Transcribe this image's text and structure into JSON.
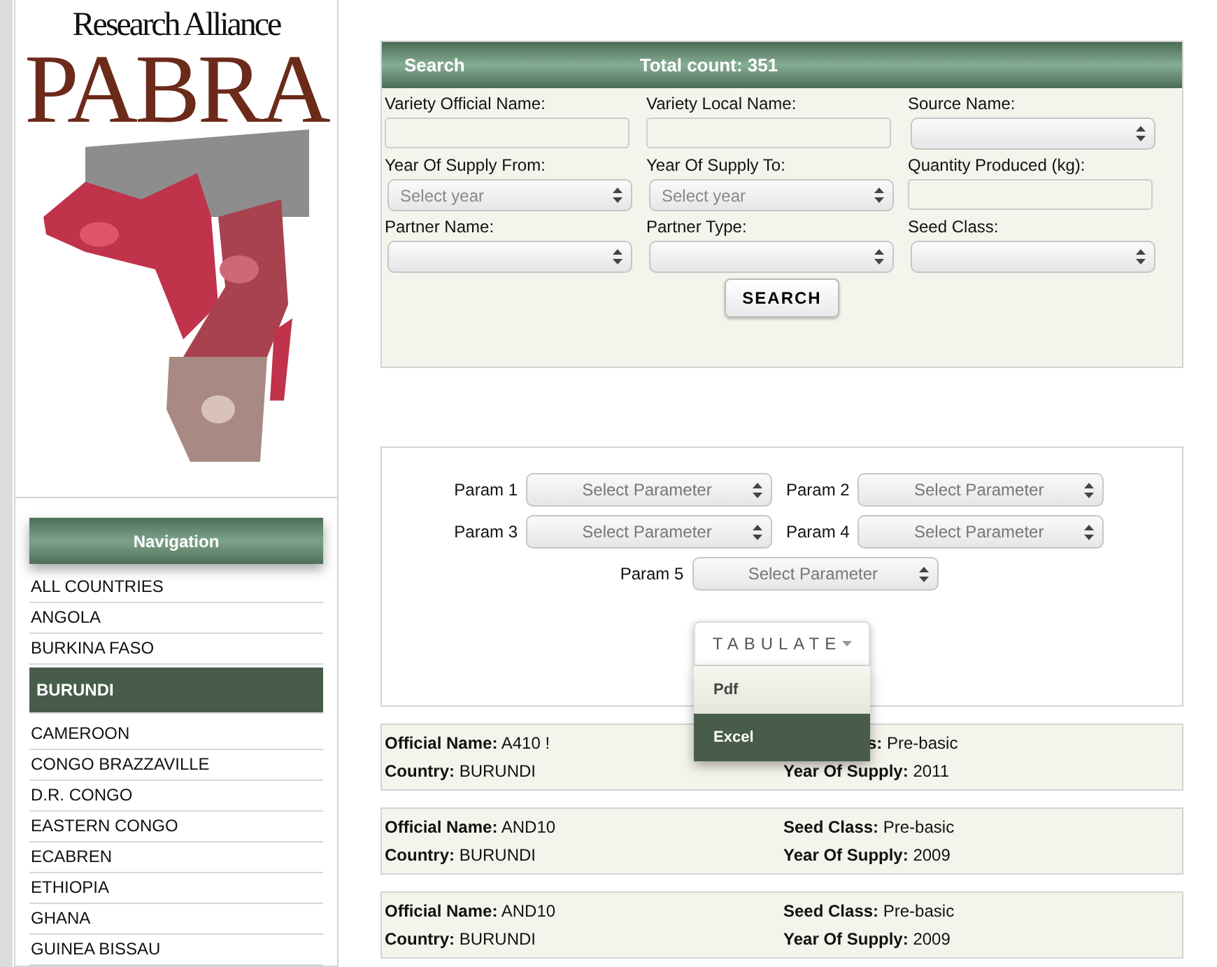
{
  "logo": {
    "subtitle": "Research Alliance",
    "title": "PABRA",
    "kind": "picture"
  },
  "navigation": {
    "title": "Navigation",
    "items": [
      {
        "label": "ALL COUNTRIES",
        "selected": false
      },
      {
        "label": "ANGOLA",
        "selected": false
      },
      {
        "label": "BURKINA FASO",
        "selected": false
      },
      {
        "label": "BURUNDI",
        "selected": true
      },
      {
        "label": "CAMEROON",
        "selected": false
      },
      {
        "label": "CONGO BRAZZAVILLE",
        "selected": false
      },
      {
        "label": "D.R. CONGO",
        "selected": false
      },
      {
        "label": "EASTERN CONGO",
        "selected": false
      },
      {
        "label": "ECABREN",
        "selected": false
      },
      {
        "label": "ETHIOPIA",
        "selected": false
      },
      {
        "label": "GHANA",
        "selected": false
      },
      {
        "label": "GUINEA BISSAU",
        "selected": false
      }
    ]
  },
  "search": {
    "title": "Search",
    "total": "Total count: 351",
    "fields": [
      {
        "label": "Variety Official Name:",
        "kind": "text"
      },
      {
        "label": "Variety Local Name:",
        "kind": "text"
      },
      {
        "label": "Source Name:",
        "kind": "select"
      },
      {
        "label": "Year Of Supply From:",
        "kind": "select",
        "placeholder": "Select year"
      },
      {
        "label": "Year Of Supply To:",
        "kind": "select",
        "placeholder": "Select year"
      },
      {
        "label": "Quantity Produced (kg):",
        "kind": "text"
      },
      {
        "label": "Partner Name:",
        "kind": "select"
      },
      {
        "label": "Partner Type:",
        "kind": "select"
      },
      {
        "label": "Seed Class:",
        "kind": "select"
      }
    ],
    "button": "SEARCH"
  },
  "tabulate": {
    "params": [
      {
        "label": "Param 1",
        "placeholder": "Select Parameter"
      },
      {
        "label": "Param 2",
        "placeholder": "Select Parameter"
      },
      {
        "label": "Param 3",
        "placeholder": "Select Parameter"
      },
      {
        "label": "Param 4",
        "placeholder": "Select Parameter"
      },
      {
        "label": "Param 5",
        "placeholder": "Select Parameter"
      }
    ],
    "button": "TABULATE",
    "expanded": true,
    "menu": [
      {
        "label": "Pdf",
        "selected": false
      },
      {
        "label": "Excel",
        "selected": true
      }
    ]
  },
  "records": [
    {
      "fields": [
        {
          "label": "Official Name:",
          "value": "A410 !"
        },
        {
          "label": "s:",
          "value": "Pre-basic",
          "covered": true
        },
        {
          "label": "Country:",
          "value": "BURUNDI"
        },
        {
          "label": "Year Of Supply:",
          "value": "2011"
        }
      ]
    },
    {
      "fields": [
        {
          "label": "Official Name:",
          "value": "AND10"
        },
        {
          "label": "Seed Class:",
          "value": "Pre-basic"
        },
        {
          "label": "Country:",
          "value": "BURUNDI"
        },
        {
          "label": "Year Of Supply:",
          "value": "2009"
        }
      ]
    },
    {
      "fields": [
        {
          "label": "Official Name:",
          "value": "AND10"
        },
        {
          "label": "Seed Class:",
          "value": "Pre-basic"
        },
        {
          "label": "Country:",
          "value": "BURUNDI"
        },
        {
          "label": "Year Of Supply:",
          "value": "2009"
        }
      ]
    }
  ]
}
